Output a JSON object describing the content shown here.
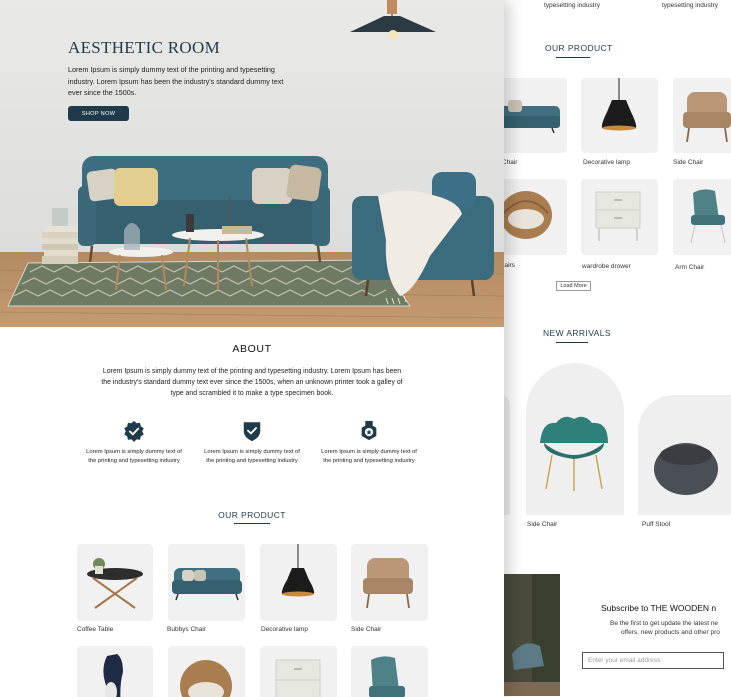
{
  "back": {
    "top_captions": [
      "typesetting industry",
      "typesetting industry"
    ],
    "our_product_title": "OUR PRODUCT",
    "products": [
      {
        "label": "bys Chair"
      },
      {
        "label": "Decorative lamp"
      },
      {
        "label": "Side Chair"
      },
      {
        "label": "er chairs"
      },
      {
        "label": "wardrobe drower"
      },
      {
        "label": "Arm Chair"
      }
    ],
    "load_more": "Load More",
    "new_arrivals_title": "NEW ARRIVALS",
    "arrivals": [
      {
        "label": "Side Chair"
      },
      {
        "label": "Puff Stool"
      }
    ],
    "subscribe": {
      "title": "Subscribe to THE WOODEN  n",
      "text_line1": "Be the first to get update the latest ne",
      "text_line2": "offers, new products and other pro",
      "email_placeholder": "Enter your email address"
    }
  },
  "hero": {
    "title": "AESTHETIC ROOM",
    "text": "Lorem Ipsum is simply dummy text of the printing and typesetting industry. Lorem Ipsum has been the industry's standard dummy text ever since the 1500s.",
    "button": "SHOP NOW"
  },
  "about": {
    "title": "ABOUT",
    "text": "Lorem Ipsum is simply dummy text of the printing and typesetting industry. Lorem Ipsum has been the industry's standard dummy text ever since the 1500s, when an unknown printer took a galley of type and scrambled it to make a type specimen book.",
    "features": [
      {
        "icon": "verified-badge-icon",
        "text": "Lorem Ipsum is simply dummy text of the printing and typesetting industry"
      },
      {
        "icon": "shield-check-icon",
        "text": "Lorem Ipsum is simply dummy text of the printing and typesetting industry"
      },
      {
        "icon": "award-medal-icon",
        "text": "Lorem Ipsum is simply dummy text of the printing and typesetting industry"
      }
    ]
  },
  "our_product": {
    "title": "OUR PRODUCT",
    "items": [
      {
        "label": "Coffee Table"
      },
      {
        "label": "Bubbys Chair"
      },
      {
        "label": "Decorative lamp"
      },
      {
        "label": "Side Chair"
      }
    ]
  },
  "colors": {
    "accent": "#1f3a4a",
    "sofa": "#3f6f80",
    "tile": "#f1f1f1"
  }
}
